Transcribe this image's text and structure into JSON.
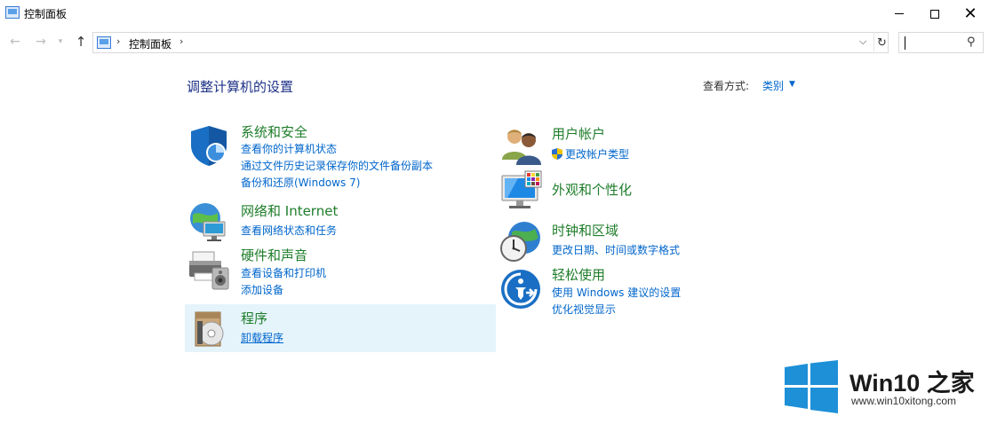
{
  "window": {
    "title": "控制面板",
    "minimize_label": "",
    "maximize_label": "",
    "close_label": "✕"
  },
  "nav": {
    "back_glyph": "←",
    "forward_glyph": "→",
    "history_glyph": "▾",
    "up_glyph": "↑"
  },
  "address": {
    "separator": "›",
    "crumb": "控制面板",
    "dropdown_glyph": "⌵",
    "refresh_glyph": "↻"
  },
  "search": {
    "placeholder": "",
    "value": "",
    "icon_glyph": "⚲"
  },
  "page": {
    "heading": "调整计算机的设置",
    "view_by_label": "查看方式:",
    "view_by_value": "类别",
    "view_by_caret": "▼"
  },
  "categories_left": [
    {
      "title": "系统和安全",
      "icon": "shield-icon",
      "links": [
        "查看你的计算机状态",
        "通过文件历史记录保存你的文件备份副本",
        "备份和还原(Windows 7)"
      ]
    },
    {
      "title": "网络和 Internet",
      "icon": "network-globe-icon",
      "links": [
        "查看网络状态和任务"
      ]
    },
    {
      "title": "硬件和声音",
      "icon": "printer-speaker-icon",
      "links": [
        "查看设备和打印机",
        "添加设备"
      ]
    },
    {
      "title": "程序",
      "icon": "programs-disc-icon",
      "links": [
        "卸载程序"
      ]
    }
  ],
  "categories_right": [
    {
      "title": "用户帐户",
      "icon": "users-icon",
      "links": [
        "更改帐户类型"
      ]
    },
    {
      "title": "外观和个性化",
      "icon": "monitor-palette-icon",
      "links": []
    },
    {
      "title": "时钟和区域",
      "icon": "clock-globe-icon",
      "links": [
        "更改日期、时间或数字格式"
      ]
    },
    {
      "title": "轻松使用",
      "icon": "accessibility-icon",
      "links": [
        "使用 Windows 建议的设置",
        "优化视觉显示"
      ]
    }
  ],
  "watermark": {
    "title": "Win10 之家",
    "url": "www.win10xitong.com"
  },
  "colors": {
    "category_title": "#1e7d2a",
    "link": "#0066cc",
    "heading": "#1e3287",
    "hover_bg": "#e5f3fb",
    "win_logo": "#1e90d8"
  }
}
